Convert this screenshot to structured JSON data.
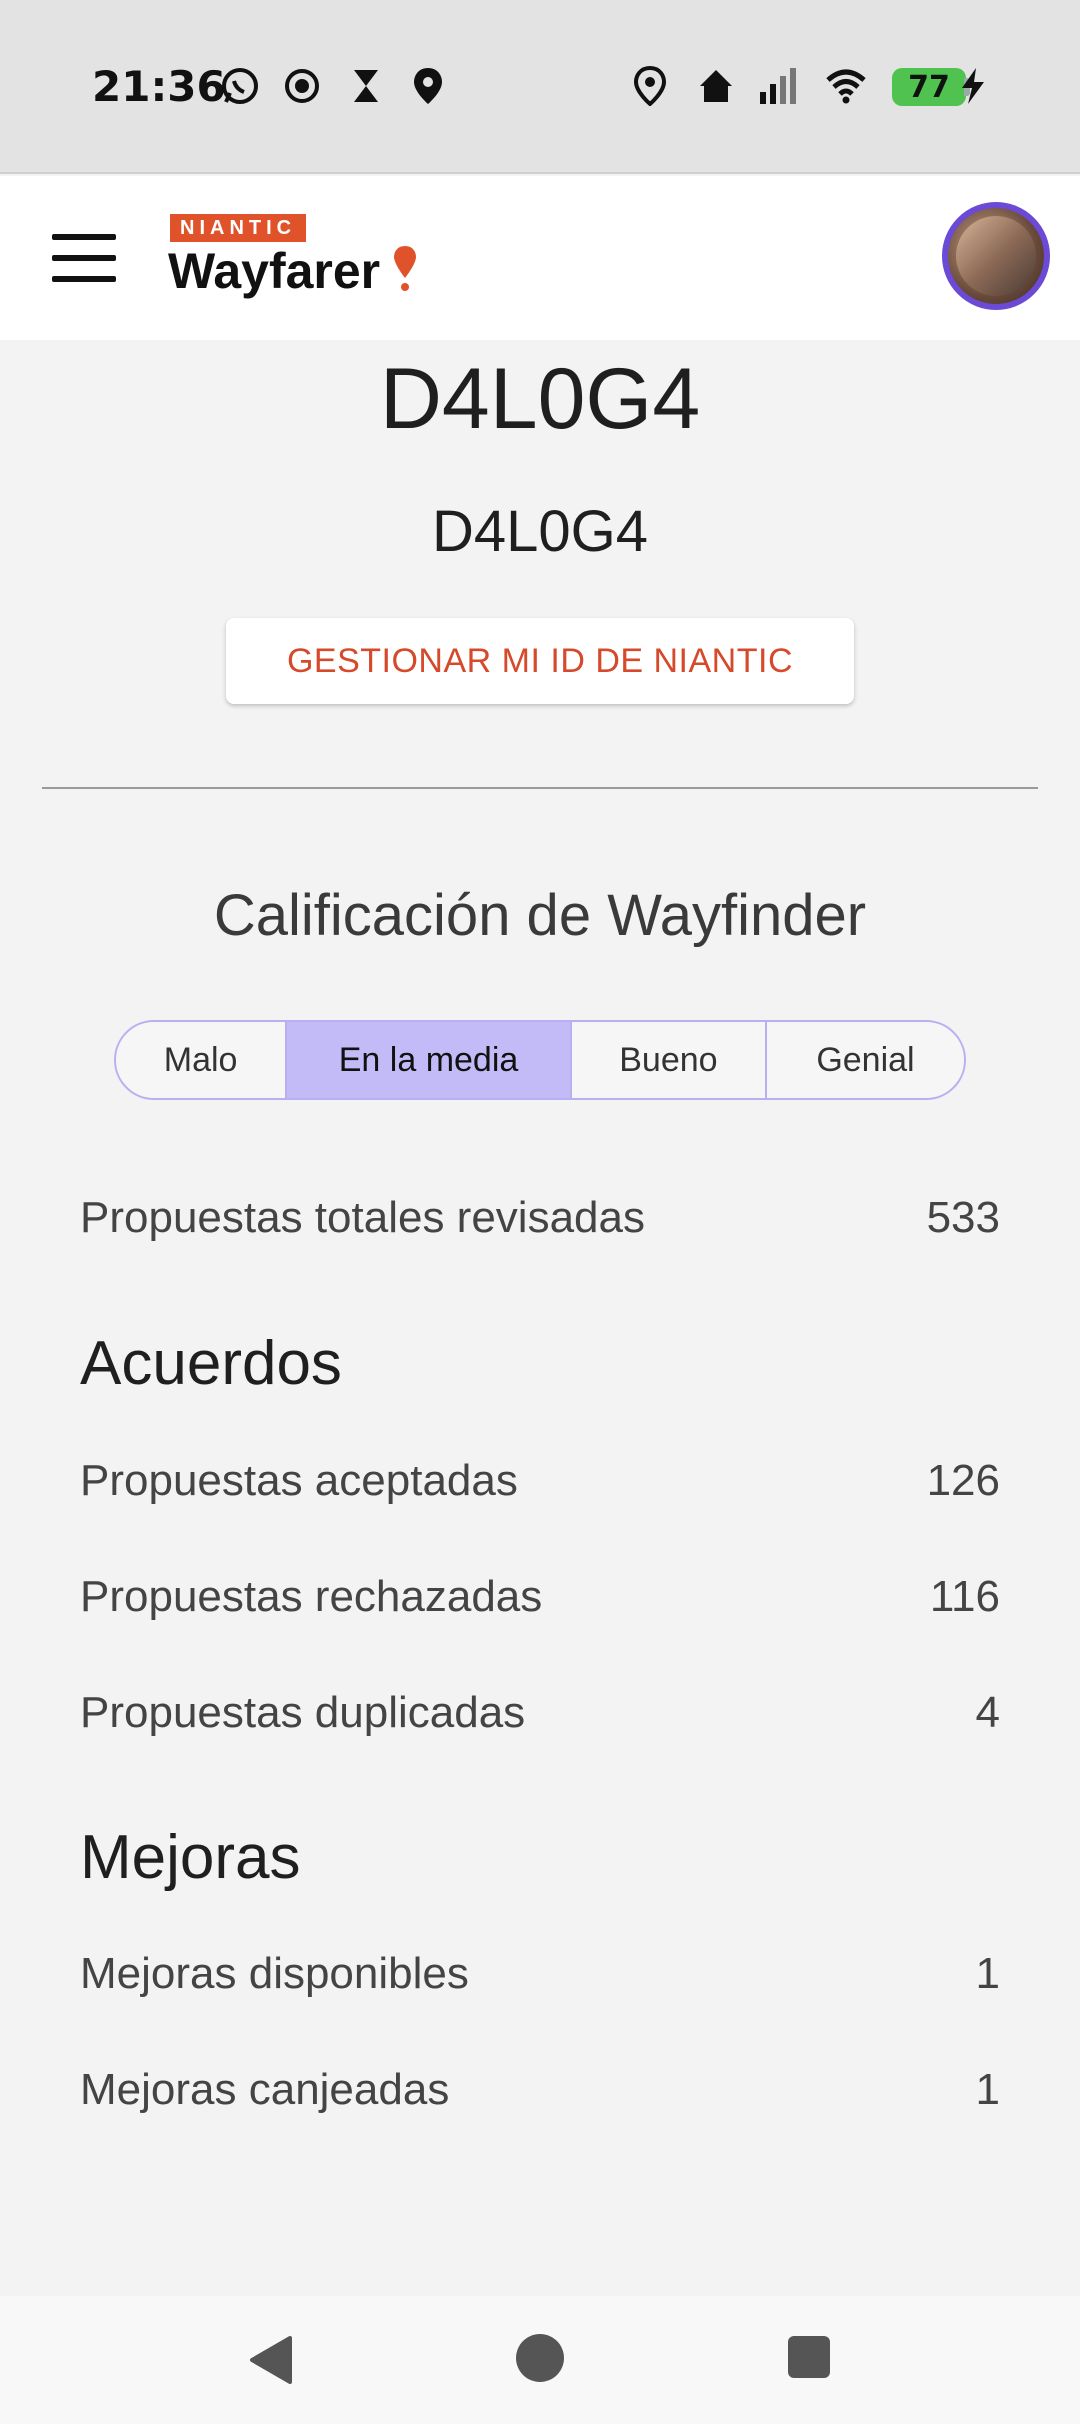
{
  "status_bar": {
    "time": "21:36",
    "battery": "77",
    "icons": [
      "whatsapp-icon",
      "screen-record-icon",
      "hourglass-icon",
      "location-icon",
      "location-icon",
      "home-icon",
      "signal-icon",
      "wifi-icon",
      "charging-icon"
    ]
  },
  "header": {
    "logo_badge": "NIANTIC",
    "logo_word": "Wayfarer",
    "menu_icon": "hamburger-icon",
    "avatar": "profile-avatar"
  },
  "profile": {
    "name": "D4L0G4",
    "username": "D4L0G4",
    "manage_button": "GESTIONAR MI ID DE NIANTIC"
  },
  "rating": {
    "title": "Calificación de Wayfinder",
    "options": [
      "Malo",
      "En la media",
      "Bueno",
      "Genial"
    ],
    "selected": "En la media"
  },
  "stats": {
    "total_label": "Propuestas totales revisadas",
    "total_value": "533",
    "agreements_heading": "Acuerdos",
    "accepted_label": "Propuestas aceptadas",
    "accepted_value": "126",
    "rejected_label": "Propuestas rechazadas",
    "rejected_value": "116",
    "duplicated_label": "Propuestas duplicadas",
    "duplicated_value": "4",
    "upgrades_heading": "Mejoras",
    "available_label": "Mejoras disponibles",
    "available_value": "1",
    "redeemed_label": "Mejoras canjeadas",
    "redeemed_value": "1"
  },
  "colors": {
    "accent": "#d6492a",
    "rating_selected": "#c2bbf7",
    "rating_border": "#b9b0f2",
    "avatar_ring": "#6b4ad6"
  }
}
